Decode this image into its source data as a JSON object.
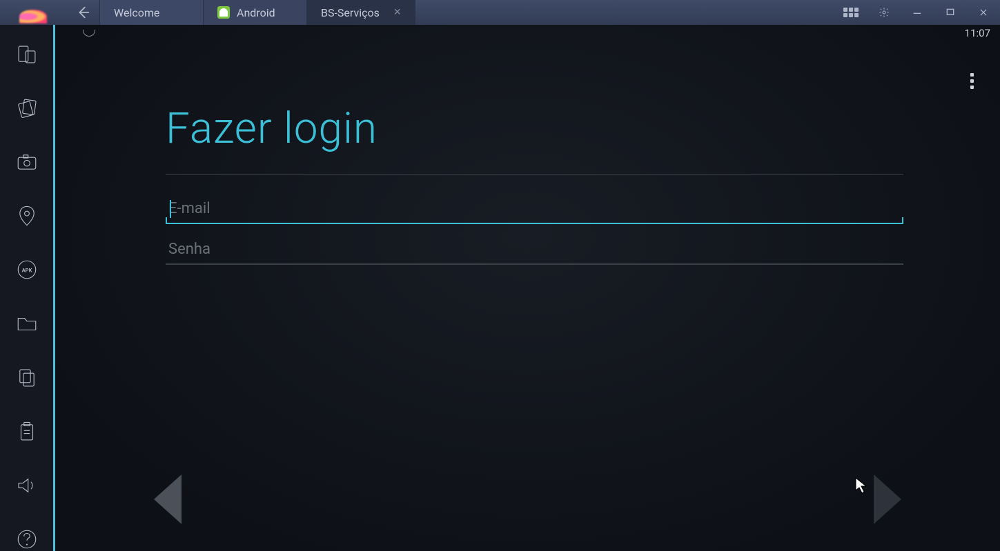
{
  "window": {
    "tabs": [
      {
        "label": "Welcome",
        "kind": "welcome"
      },
      {
        "label": "Android",
        "kind": "android"
      },
      {
        "label": "BS-Serviços",
        "kind": "active"
      }
    ]
  },
  "statusbar": {
    "time": "11:07"
  },
  "login": {
    "title": "Fazer login",
    "email_placeholder": "E-mail",
    "email_value": "",
    "password_placeholder": "Senha",
    "password_value": ""
  },
  "sidebar_items": [
    "devices-icon",
    "rotate-icon",
    "camera-icon",
    "location-icon",
    "apk-icon",
    "folder-icon",
    "copy-icon",
    "paste-icon",
    "volume-icon",
    "help-icon"
  ],
  "colors": {
    "accent": "#3cc0d8"
  }
}
